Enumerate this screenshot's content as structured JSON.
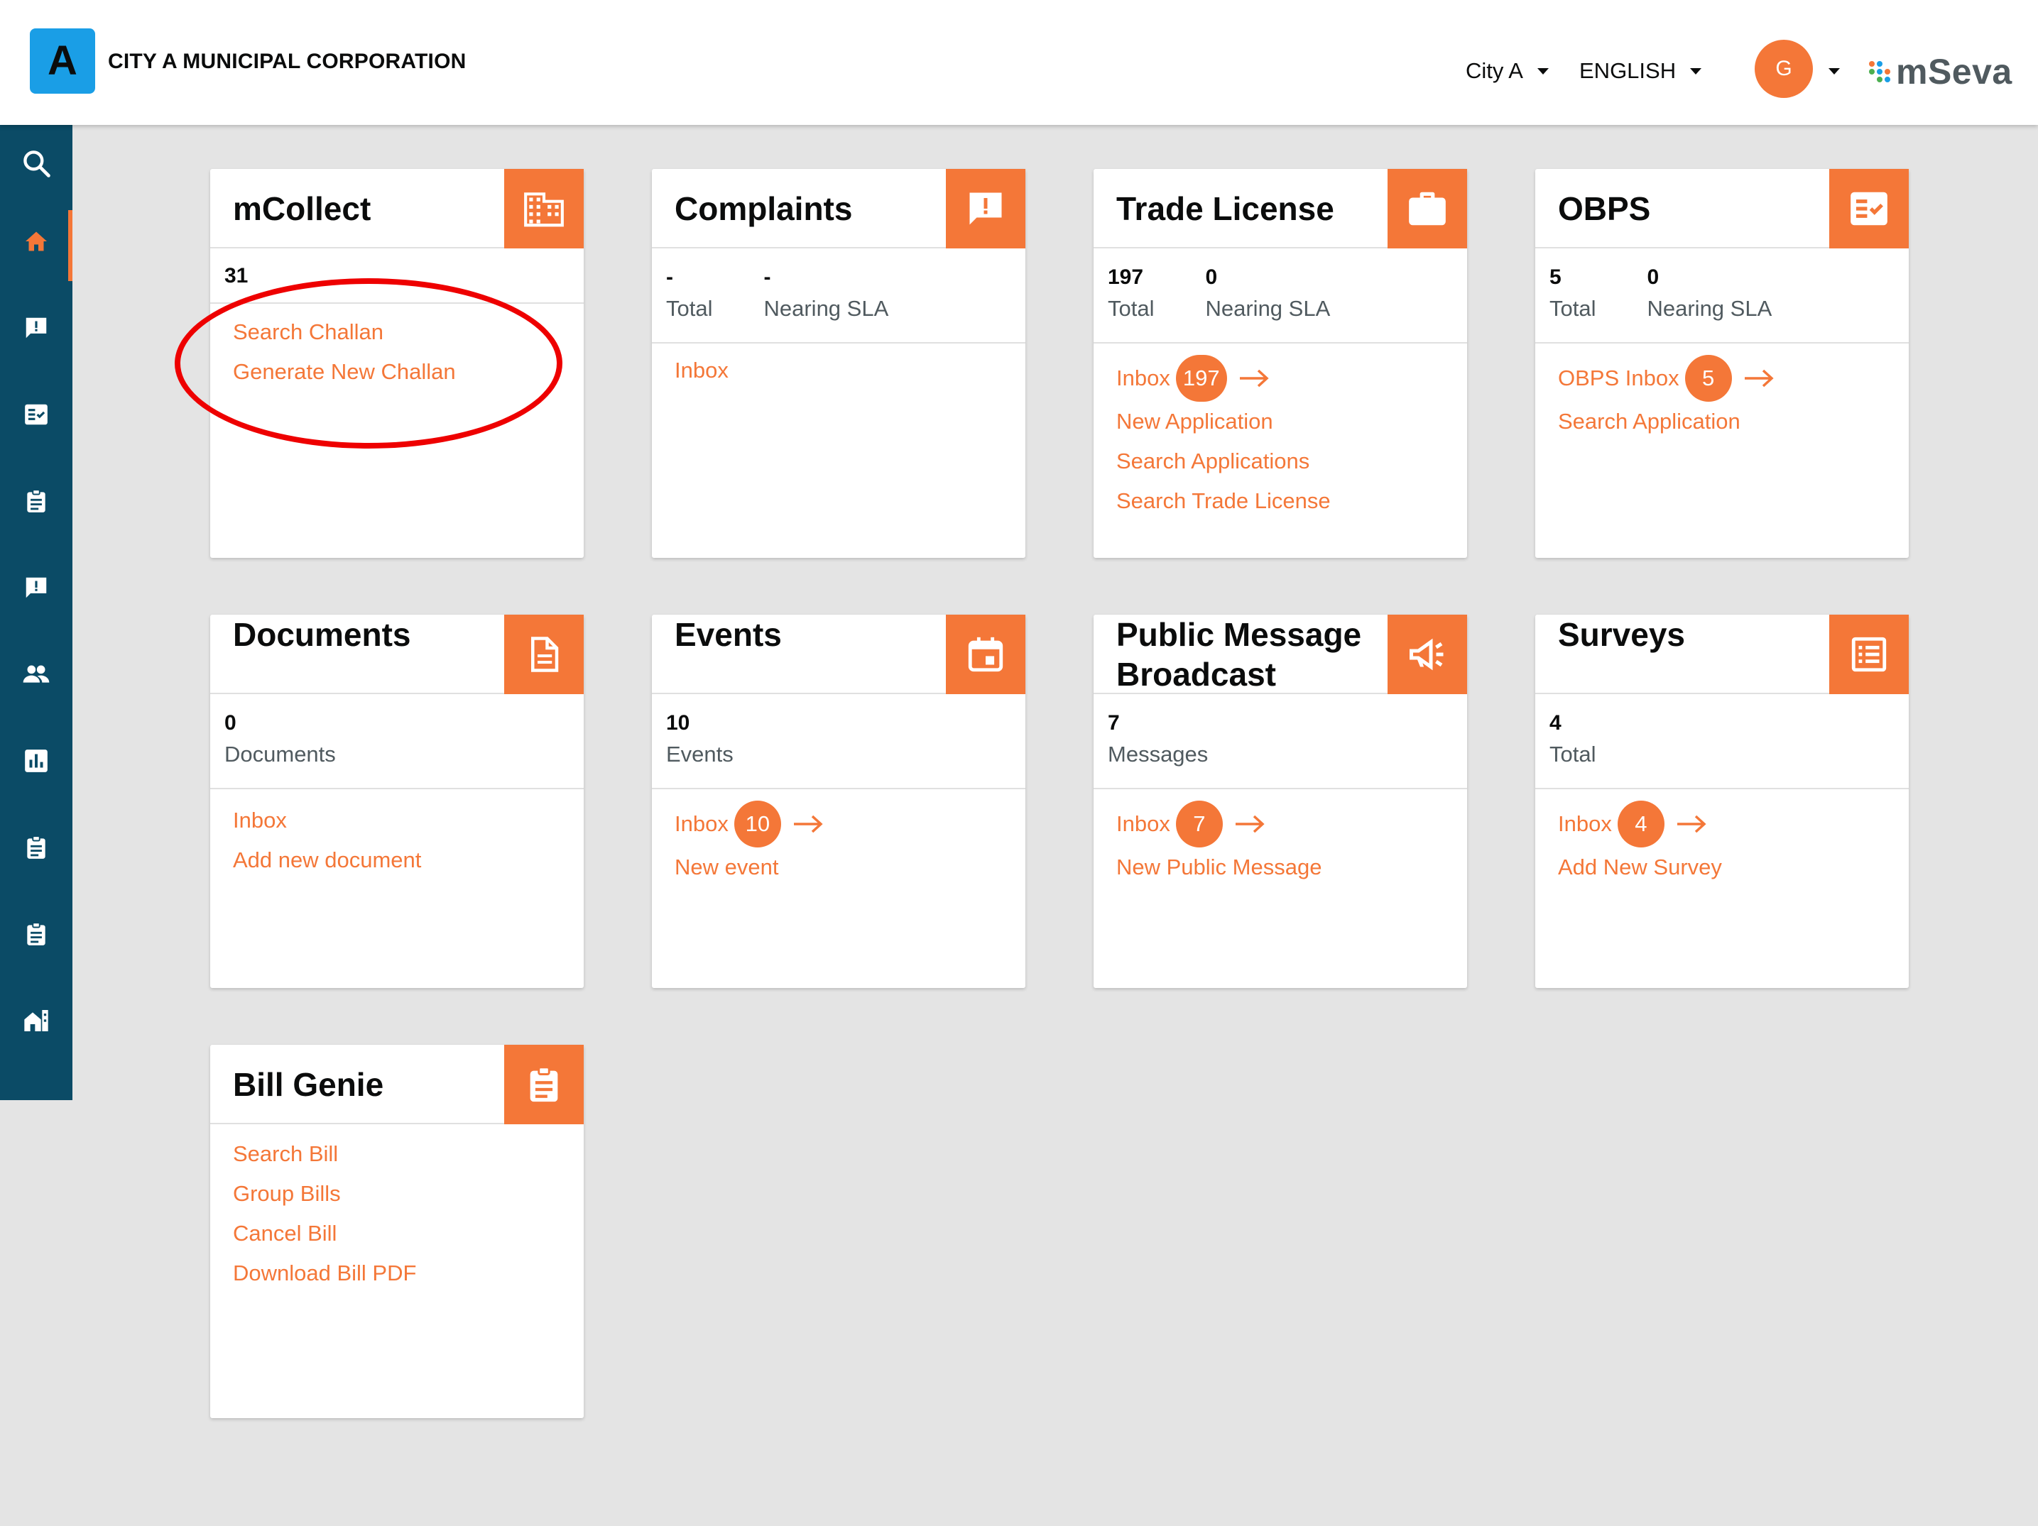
{
  "header": {
    "logo_letter": "A",
    "city_name": "CITY A MUNICIPAL CORPORATION",
    "city_selector": "City A",
    "language_selector": "ENGLISH",
    "user_initial": "G",
    "brand": "mSeva"
  },
  "sidebar": {
    "items": [
      "search-icon",
      "home-icon",
      "complaint-icon",
      "checklist-icon",
      "clipboard-icon",
      "complaint-icon",
      "people-icon",
      "chart-icon",
      "clipboard-icon",
      "clipboard-icon",
      "city-icon"
    ]
  },
  "cards": {
    "mcollect": {
      "title": "mCollect",
      "stat_value": "31",
      "links": [
        "Search Challan",
        "Generate New Challan"
      ]
    },
    "complaints": {
      "title": "Complaints",
      "total_value": "-",
      "total_label": "Total",
      "sla_value": "-",
      "sla_label": "Nearing SLA",
      "links": [
        "Inbox"
      ]
    },
    "trade_license": {
      "title": "Trade License",
      "total_value": "197",
      "total_label": "Total",
      "sla_value": "0",
      "sla_label": "Nearing SLA",
      "inbox_label": "Inbox",
      "inbox_count": "197",
      "links": [
        "New Application",
        "Search Applications",
        "Search Trade License"
      ]
    },
    "obps": {
      "title": "OBPS",
      "total_value": "5",
      "total_label": "Total",
      "sla_value": "0",
      "sla_label": "Nearing SLA",
      "inbox_label": "OBPS Inbox",
      "inbox_count": "5",
      "links": [
        "Search Application"
      ]
    },
    "documents": {
      "title": "Documents",
      "stat_value": "0",
      "stat_label": "Documents",
      "links": [
        "Inbox",
        "Add new document"
      ]
    },
    "events": {
      "title": "Events",
      "stat_value": "10",
      "stat_label": "Events",
      "inbox_label": "Inbox",
      "inbox_count": "10",
      "links": [
        "New event"
      ]
    },
    "pmb": {
      "title": "Public Message Broadcast",
      "stat_value": "7",
      "stat_label": "Messages",
      "inbox_label": "Inbox",
      "inbox_count": "7",
      "links": [
        "New Public Message"
      ]
    },
    "surveys": {
      "title": "Surveys",
      "stat_value": "4",
      "stat_label": "Total",
      "inbox_label": "Inbox",
      "inbox_count": "4",
      "links": [
        "Add New Survey"
      ]
    },
    "bill_genie": {
      "title": "Bill Genie",
      "links": [
        "Search Bill",
        "Group Bills",
        "Cancel Bill",
        "Download Bill PDF"
      ]
    }
  },
  "colors": {
    "accent": "#f47738",
    "sidebar": "#0b4b66",
    "annotation": "#ee0000"
  }
}
